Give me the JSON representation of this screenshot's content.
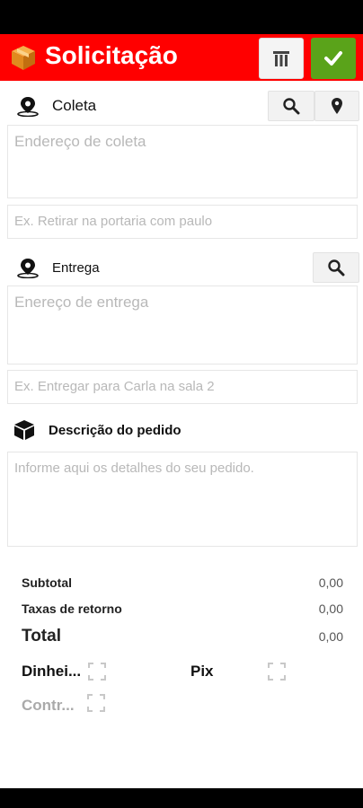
{
  "header": {
    "title": "Solicitação",
    "brand_color": "#ff0000",
    "confirm_color": "#5aa31a"
  },
  "icons": {
    "logo": "package-box-icon",
    "trash": "trash-icon",
    "confirm": "checkmark-icon",
    "search": "search-icon",
    "map_pin": "map-pin-icon",
    "location": "location-pin-icon",
    "box": "cube-icon"
  },
  "pickup": {
    "label": "Coleta",
    "address_placeholder": "Endereço de coleta",
    "note_placeholder": "Ex. Retirar na portaria com paulo"
  },
  "delivery": {
    "label": "Entrega",
    "address_placeholder": "Enereço de entrega",
    "note_placeholder": "Ex. Entregar para Carla na sala 2"
  },
  "order": {
    "label": "Descrição do pedido",
    "placeholder": "Informe aqui os detalhes do seu pedido."
  },
  "summary": {
    "subtotal_label": "Subtotal",
    "subtotal_value": "0,00",
    "return_fee_label": "Taxas de retorno",
    "return_fee_value": "0,00",
    "total_label": "Total",
    "total_value": "0,00"
  },
  "payment": {
    "cash": "Dinhei...",
    "pix": "Pix",
    "contract": "Contr..."
  }
}
